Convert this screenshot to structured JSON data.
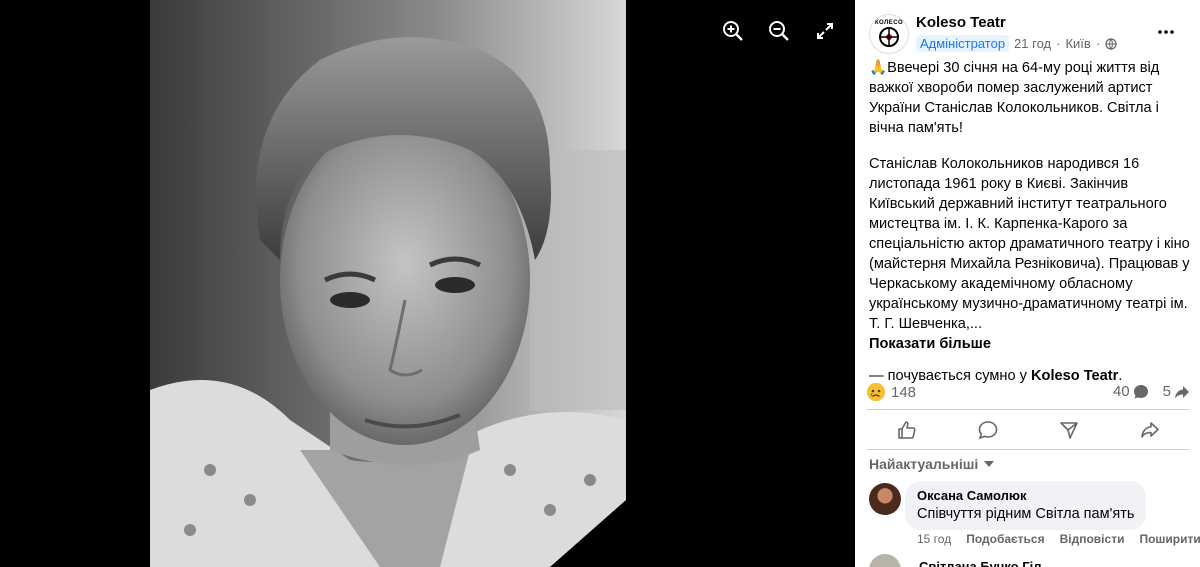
{
  "post": {
    "page_name": "Koleso Teatr",
    "logo_text": "КОЛЕСО",
    "role_badge": "Адміністратор",
    "time": "21 год",
    "separator": "·",
    "location": "Київ",
    "paragraph1": "🙏Ввечері 30 січня на 64-му році життя від важкої хвороби помер заслужений артист України Станіслав Колокольников. Світла і вічна пам'ять!",
    "paragraph2": "Станіслав Колокольников народився 16 листопада 1961 року в Києві. Закінчив Київський державний інститут театрального мистецтва ім. І. К. Карпенка-Карого за спеціальністю актор драматичного театру і кіно (майстерня Михайла Резніковича). Працював у Черкаському академічному обласному українському музично-драматичному театрі ім. Т. Г. Шевченка,...",
    "see_more": "Показати більше",
    "feeling_prefix": "— почувається сумно у ",
    "feeling_page": "Koleso Teatr",
    "feeling_suffix": "."
  },
  "stats": {
    "reaction_icon": "sad-face-emoji",
    "reactions": "148",
    "comments": "40",
    "shares": "5"
  },
  "icons": {
    "zoom_in": "zoom-in-icon",
    "zoom_out": "zoom-out-icon",
    "fullscreen": "fullscreen-icon",
    "more": "more-dots-icon",
    "globe": "globe-icon",
    "like": "like-icon",
    "comment": "comment-icon",
    "send": "send-icon",
    "share": "share-icon"
  },
  "comments": {
    "sort_label": "Найактуальніші",
    "items": [
      {
        "author": "Оксана Самолюк",
        "text": "Співчуття рідним Світла пам'ять",
        "time": "15 год",
        "reply": "Відповісти",
        "share": "Поширити",
        "extra": "Подобається"
      },
      {
        "author": "Світлана Бучко Гіл"
      }
    ]
  },
  "colors": {
    "accent": "#1877f2",
    "muted": "#65676b",
    "bubble": "#f0f2f5"
  }
}
